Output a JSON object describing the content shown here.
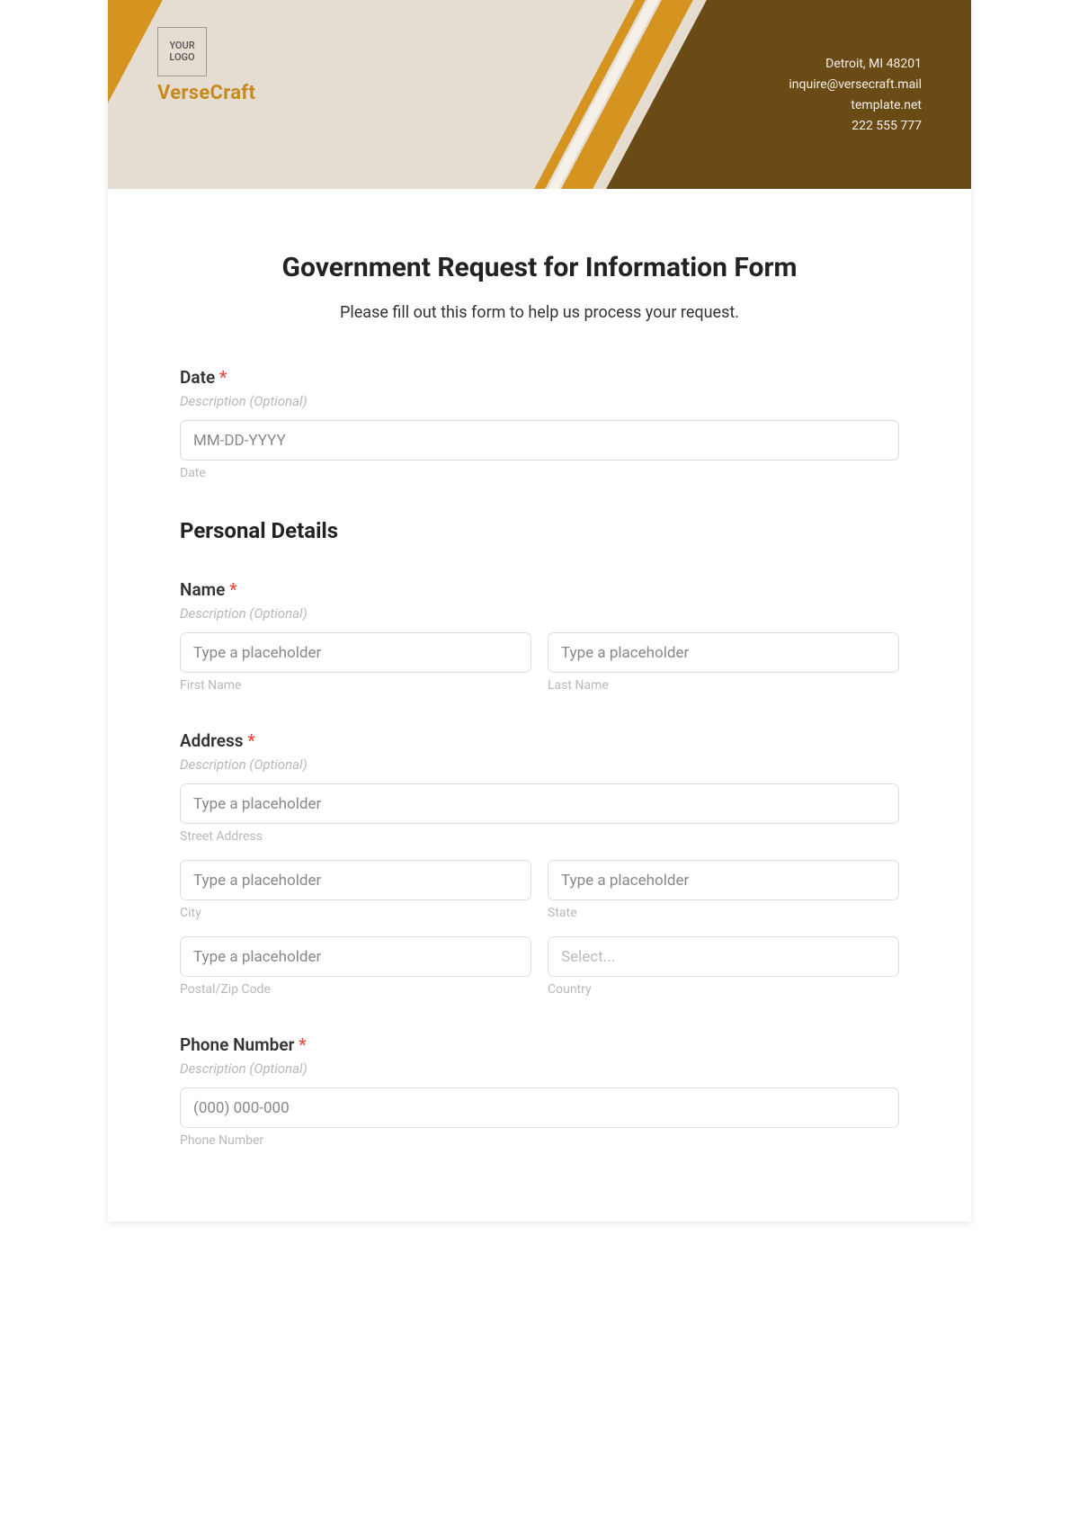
{
  "header": {
    "logo_text": "YOUR LOGO",
    "brand": "VerseCraft",
    "contact": {
      "line1": "Detroit, MI 48201",
      "line2": "inquire@versecraft.mail",
      "line3": "template.net",
      "line4": "222 555 777"
    }
  },
  "form": {
    "title": "Government Request for Information Form",
    "subtitle": "Please fill out this form to help us process your request.",
    "desc_optional": "Description (Optional)",
    "fields": {
      "date": {
        "label": "Date",
        "placeholder": "MM-DD-YYYY",
        "sub": "Date"
      },
      "personal_section": "Personal Details",
      "name": {
        "label": "Name",
        "first_ph": "Type a placeholder",
        "last_ph": "Type a placeholder",
        "first_sub": "First Name",
        "last_sub": "Last Name"
      },
      "address": {
        "label": "Address",
        "street_ph": "Type a placeholder",
        "street_sub": "Street Address",
        "city_ph": "Type a placeholder",
        "city_sub": "City",
        "state_ph": "Type a placeholder",
        "state_sub": "State",
        "postal_ph": "Type a placeholder",
        "postal_sub": "Postal/Zip Code",
        "country_ph": "Select...",
        "country_sub": "Country"
      },
      "phone": {
        "label": "Phone Number",
        "placeholder": "(000) 000-000",
        "sub": "Phone Number"
      }
    }
  }
}
